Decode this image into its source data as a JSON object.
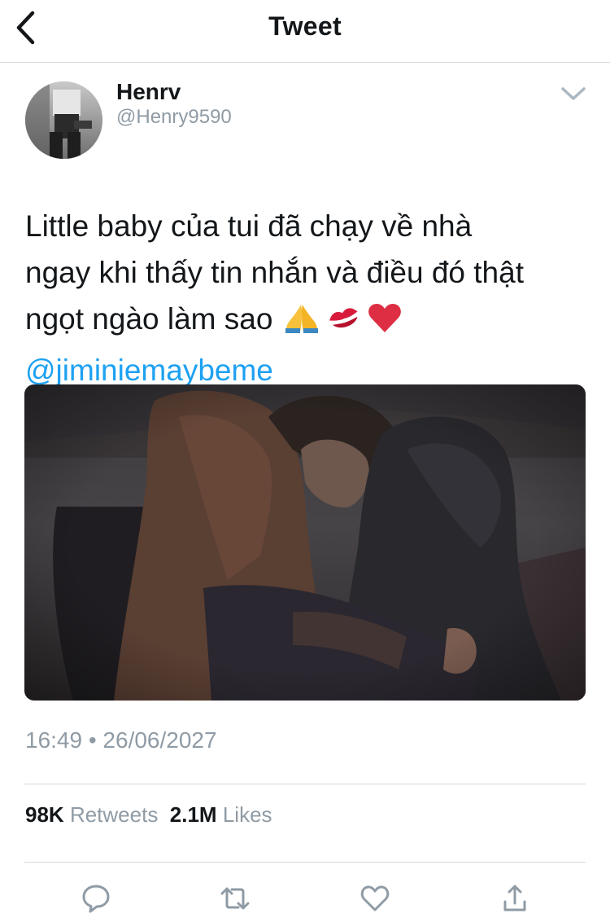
{
  "header": {
    "title": "Tweet"
  },
  "author": {
    "display_name": "Henrv",
    "handle": "@Henry9590"
  },
  "tweet": {
    "lines": [
      "Little baby của tui đã chạy về nhà",
      "ngay khi thấy tin nhắn và điều đó thật",
      "ngọt ngào làm sao"
    ],
    "emojis": [
      "folded-hands-icon",
      "kiss-mark-icon",
      "red-heart-icon"
    ],
    "mention": "@jiminiemaybeme",
    "timestamp": "16:49 • 26/06/2027"
  },
  "stats": {
    "retweets_count": "98K",
    "retweets_label": "Retweets",
    "likes_count": "2.1M",
    "likes_label": "Likes"
  },
  "actions": [
    "reply-icon",
    "retweet-icon",
    "like-icon",
    "share-icon"
  ],
  "colors": {
    "link": "#1da1f2",
    "secondary_text": "#8f9ba5",
    "divider": "#d6d9dc",
    "primary_text": "#14171a"
  }
}
